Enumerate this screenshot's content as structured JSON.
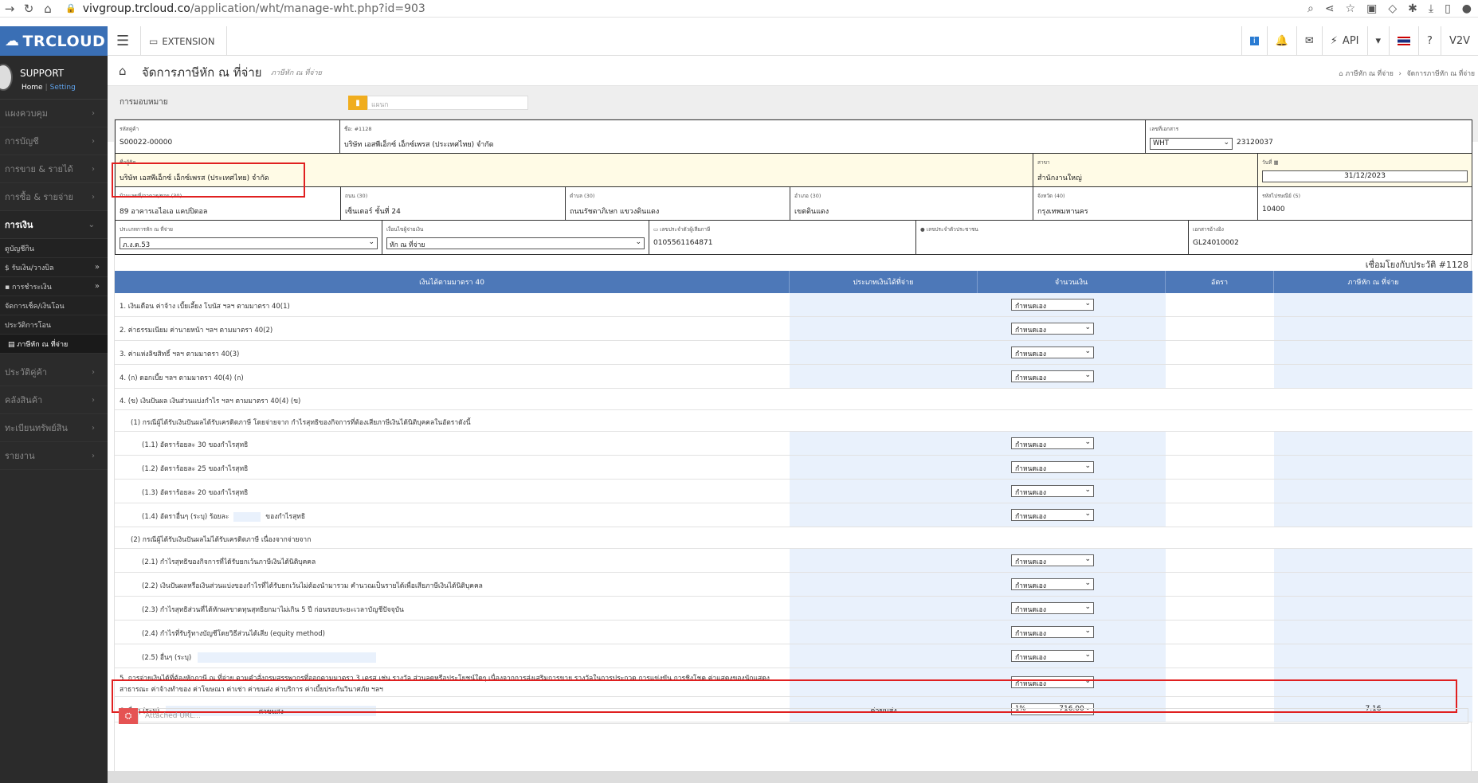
{
  "browser": {
    "url_host": "vivgroup.trcloud.co",
    "url_path": "/application/wht/manage-wht.php?id=903"
  },
  "header": {
    "logo": "TRCLOUD",
    "extension": "EXTENSION",
    "api": "API",
    "user": "V2V"
  },
  "sidebar": {
    "profile_name": "SUPPORT",
    "profile_home": "Home",
    "profile_sep": "|",
    "profile_setting": "Setting",
    "items": [
      {
        "label": "แผงควบคุม"
      },
      {
        "label": "การบัญชี"
      },
      {
        "label": "การขาย & รายได้"
      },
      {
        "label": "การซื้อ & รายจ่าย"
      },
      {
        "label": "การเงิน"
      }
    ],
    "subitems": [
      {
        "label": "ดูบัญชีกิน"
      },
      {
        "label": "$ รับเงิน/วางบิล"
      },
      {
        "label": "การชำระเงิน"
      },
      {
        "label": "จัดการเช็ค/เงินโอน"
      },
      {
        "label": "ประวัติการโอน"
      },
      {
        "label": "ภาษีหัก ณ ที่จ่าย"
      }
    ],
    "items2": [
      {
        "label": "ประวัติคู่ค้า"
      },
      {
        "label": "คลังสินค้า"
      },
      {
        "label": "ทะเบียนทรัพย์สิน"
      },
      {
        "label": "รายงาน"
      }
    ]
  },
  "page": {
    "title": "จัดการภาษีหัก ณ ที่จ่าย",
    "subtitle": "ภาษีหัก ณ ที่จ่าย",
    "breadcrumb_1": "ภาษีหัก ณ ที่จ่าย",
    "breadcrumb_sep": "›",
    "breadcrumb_2": "จัดการภาษีหัก ณ ที่จ่าย",
    "assign_label": "การมอบหมาย",
    "assign_placeholder": "แผนก",
    "link_history": "เชื่อมโยงกับประวัติ #1128"
  },
  "info": {
    "customer_code_label": "รหัสคู่ค้า",
    "customer_code": "S00022-00000",
    "name_label": "ชื่อ: #1128",
    "name": "บริษัท เอสพีเอ็กซ์ เอ็กซ์เพรส (ประเทศไทย) จำกัด",
    "docno_label": "เลขที่เอกสาร",
    "doc_prefix": "WHT",
    "doc_no": "23120037",
    "addr_label": "ชื่อผู้ติด",
    "addr_name": "บริษัท เอสพีเอ็กซ์ เอ็กซ์เพรส (ประเทศไทย) จำกัด",
    "branch_label": "สาขา",
    "branch": "สำนักงานใหญ่",
    "date_label": "วันที่",
    "date": "31/12/2023",
    "house_label": "บ้านเลขที่/อาคาร/ซอย (30)",
    "house": "89 อาคารเอไอเอ แคปปิตอล",
    "road_label": "ถนน (30)",
    "road": "เซ็นเตอร์ ชั้นที่ 24",
    "subdistrict_label": "ตำบล (30)",
    "subdistrict": "ถนนรัชดาภิเษก แขวงดินแดง",
    "district_label": "อำเภอ (30)",
    "district": "เขตดินแดง",
    "province_label": "จังหวัด (40)",
    "province": "กรุงเทพมหานคร",
    "postcode_label": "รหัสไปรษณีย์ (5)",
    "postcode": "10400",
    "whttype_label": "ประเภทการหัก ณ ที่จ่าย",
    "whttype": "ภ.ง.ด.53",
    "condition_label": "เงื่อนไขผู้จ่ายเงิน",
    "condition": "หัก ณ ที่จ่าย",
    "taxid_label": "เลขประจำตัวผู้เสียภาษี",
    "taxid": "0105561164871",
    "idcard_label": "เลขประจำตัวประชาชน",
    "ref_label": "เอกสารอ้างอิง",
    "ref": "GL24010002"
  },
  "table": {
    "headers": [
      "เงินได้ตามมาตรา 40",
      "ประเภทเงินได้ที่จ่าย",
      "จำนวนเงิน",
      "อัตรา",
      "ภาษีหัก ณ ที่จ่าย"
    ],
    "default_rate": "กำหนดเอง",
    "rows": [
      {
        "desc": "1. เงินเดือน ค่าจ้าง เบี้ยเลี้ยง โบนัส ฯลฯ ตามมาตรา 40(1)"
      },
      {
        "desc": "2. ค่าธรรมเนียม ค่านายหน้า ฯลฯ ตามมาตรา 40(2)"
      },
      {
        "desc": "3. ค่าแห่งลิขสิทธิ์ ฯลฯ ตามมาตรา 40(3)"
      },
      {
        "desc": "4. (ก) ดอกเบี้ย ฯลฯ ตามมาตรา 40(4) (ก)"
      },
      {
        "desc": "4. (ข) เงินปันผล เงินส่วนแบ่งกำไร ฯลฯ ตามมาตรา 40(4) (ข)"
      },
      {
        "desc": "(1) กรณีผู้ได้รับเงินปันผลได้รับเครดิตภาษี โดยจ่ายจาก กำไรสุทธิของกิจการที่ต้องเสียภาษีเงินได้นิติบุคคลในอัตราดังนี้"
      },
      {
        "desc": "(1.1) อัตราร้อยละ 30 ของกำไรสุทธิ"
      },
      {
        "desc": "(1.2) อัตราร้อยละ 25 ของกำไรสุทธิ"
      },
      {
        "desc": "(1.3) อัตราร้อยละ 20 ของกำไรสุทธิ"
      },
      {
        "desc": "(1.4) อัตราอื่นๆ (ระบุ) ร้อยละ",
        "desc2": "ของกำไรสุทธิ"
      },
      {
        "desc": "(2) กรณีผู้ได้รับเงินปันผลไม่ได้รับเครดิตภาษี เนื่องจากจ่ายจาก"
      },
      {
        "desc": "(2.1) กำไรสุทธิของกิจการที่ได้รับยกเว้นภาษีเงินได้นิติบุคคล"
      },
      {
        "desc": "(2.2) เงินปันผลหรือเงินส่วนแบ่งของกำไรที่ได้รับยกเว้นไม่ต้องนำมารวม คำนวณเป็นรายได้เพื่อเสียภาษีเงินได้นิติบุคคล"
      },
      {
        "desc": "(2.3) กำไรสุทธิส่วนที่ได้หักผลขาดทุนสุทธิยกมาไม่เกิน 5 ปี ก่อนรอบระยะเวลาบัญชีปัจจุบัน"
      },
      {
        "desc": "(2.4) กำไรที่รับรู้ทางบัญชีโดยวิธีส่วนได้เสีย (equity method)"
      },
      {
        "desc": "(2.5) อื่นๆ (ระบุ)"
      },
      {
        "desc": "5. การจ่ายเงินได้ที่ต้องหักภาษี ณ ที่จ่าย ตามคำสั่งกรมสรรพากรที่ออกตามมาตรา 3 เตรส เช่น รางวัล ส่วนลดหรือประโยชน์ใดๆ เนื่องจากการส่งเสริมการขาย รางวัลในการประกวด การแข่งขัน การชิงโชค ค่าแสดงของนักแสดง",
        "desc2": "สาธารณะ ค่าจ้างทำของ ค่าโฆษณา ค่าเช่า ค่าขนส่ง ค่าบริการ ค่าเบี้ยประกันวินาศภัย ฯลฯ"
      },
      {
        "desc": "6. อื่นๆ (ระบุ)",
        "other_text": "ค่าขนส่ง",
        "income_type": "ค่าขนส่ง",
        "amount": "716.00",
        "rate": "1%",
        "tax": "7.16"
      }
    ]
  },
  "attach": {
    "placeholder": "Attached URL..."
  }
}
